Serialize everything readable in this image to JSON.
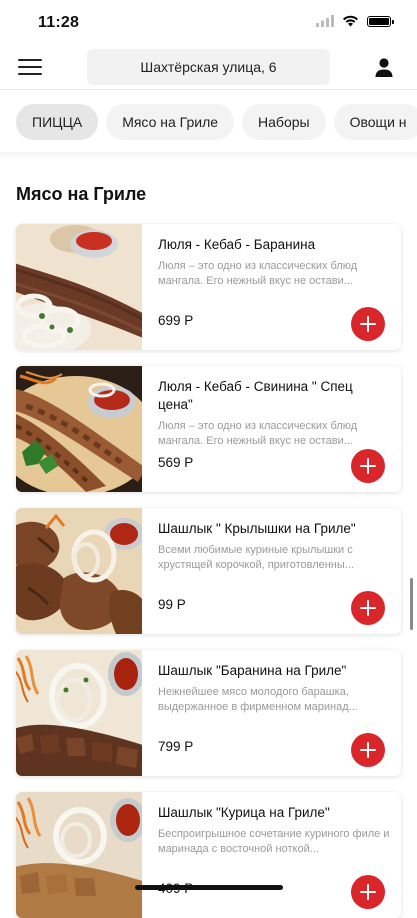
{
  "status_bar": {
    "time": "11:28"
  },
  "header": {
    "address": "Шахтёрская улица, 6"
  },
  "categories": [
    "ПИЦЦА",
    "Мясо на Гриле",
    "Наборы",
    "Овощи н"
  ],
  "section_title": "Мясо на Гриле",
  "products": [
    {
      "name": "Люля - Кебаб - Баранина",
      "description": "Люля – это одно из классических блюд мангала. Его нежный вкус  не остави...",
      "price": "699 Р"
    },
    {
      "name": "Люля - Кебаб - Свинина \" Спец цена\"",
      "description": "Люля – это одно из классических блюд мангала. Его нежный вкус  не остави...",
      "price": "569 Р"
    },
    {
      "name": "Шашлык \" Крылышки на Гриле\"",
      "description": "Всеми любимые куриные крылышки с хрустящей корочкой, приготовленны...",
      "price": "99 Р"
    },
    {
      "name": "Шашлык \"Баранина на Гриле\"",
      "description": "Нежнейшее мясо молодого барашка, выдержанное в фирменном маринад...",
      "price": "799 Р"
    },
    {
      "name": "Шашлык \"Курица на Гриле\"",
      "description": "Беспроигрышное сочетание куриного филе и маринада с восточной ноткой...",
      "price": "409 Р"
    }
  ],
  "colors": {
    "accent": "#d8262b",
    "chip_bg": "#f3f3f3",
    "chip_active_bg": "#e6e6e6"
  }
}
